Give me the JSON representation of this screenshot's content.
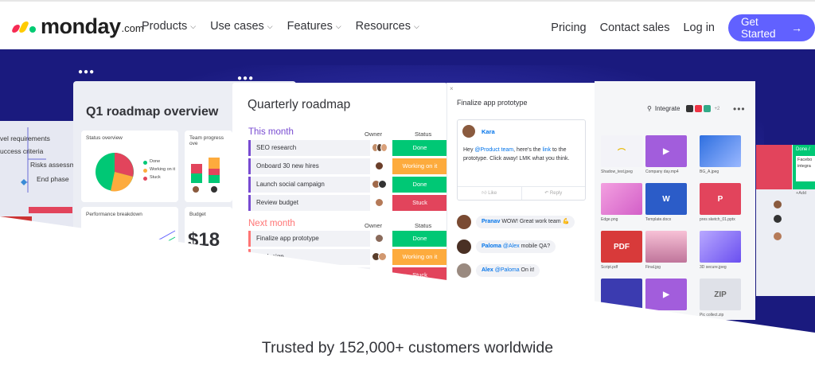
{
  "nav": {
    "logo_word": "monday",
    "logo_suffix": ".com",
    "menu": [
      {
        "label": "Products"
      },
      {
        "label": "Use cases"
      },
      {
        "label": "Features"
      },
      {
        "label": "Resources"
      }
    ],
    "pricing": "Pricing",
    "contact": "Contact sales",
    "login": "Log in",
    "cta": "Get Started",
    "cta_color": "#6161ff"
  },
  "hero": {
    "background_color": "#1a1a7e",
    "left_labels": [
      "vel requirements",
      "uccess criteria",
      "Risks assessm",
      "End phase"
    ],
    "overview": {
      "title": "Q1 roadmap overview",
      "status_overview": "Status overview",
      "legend": [
        "Done",
        "Working on it",
        "Stuck"
      ],
      "team_progress": "Team progress ove",
      "performance": "Performance breakdown",
      "budget": "Budget",
      "budget_value": "$18"
    },
    "roadmap": {
      "title": "Quarterly roadmap",
      "this_month": "This month",
      "next_month": "Next month",
      "owner_label": "Owner",
      "status_label": "Status",
      "rows_this": [
        {
          "name": "SEO research",
          "status": "Done",
          "color": "#00c875"
        },
        {
          "name": "Onboard 30 new hires",
          "status": "Working on it",
          "color": "#fdab3d"
        },
        {
          "name": "Launch social campaign",
          "status": "Done",
          "color": "#00c875"
        },
        {
          "name": "Review budget",
          "status": "Stuck",
          "color": "#e2445c"
        }
      ],
      "rows_next": [
        {
          "name": "Finalize app prototype",
          "status": "Done",
          "color": "#00c875"
        },
        {
          "name": "...edesign",
          "status": "Working on it",
          "color": "#fdab3d"
        },
        {
          "name": "",
          "status": "Stuck",
          "color": "#e2445c"
        }
      ]
    },
    "chat": {
      "close": "×",
      "title": "Finalize app prototype",
      "author": "Kara",
      "message_pre": "Hey ",
      "mention": "@Product team",
      "message_mid": ", here's the ",
      "link": "link",
      "message_post": " to the prototype. Click away! LMK what you think.",
      "like": "Like",
      "reply": "Reply",
      "replies": [
        {
          "name": "Pranav",
          "text": "WOW! Great work team 💪",
          "mention": ""
        },
        {
          "name": "Paloma",
          "mention": "@Alex",
          "text": "mobile QA?"
        },
        {
          "name": "Alex",
          "mention": "@Paloma",
          "text": "On it!"
        }
      ]
    },
    "files": {
      "integrate": "Integrate",
      "integrate_count": "+2",
      "tiles": [
        {
          "label": "",
          "caption": "Shadow_test.jpeg",
          "color": "#f3f3f8"
        },
        {
          "label": "▶",
          "caption": "Company day.mp4",
          "color": "#a25ddc"
        },
        {
          "label": "",
          "caption": "BG_A.jpeg",
          "color": "#4a78e0"
        },
        {
          "label": "",
          "caption": "Edge.png",
          "color": "#e87bd2"
        },
        {
          "label": "W",
          "caption": "Template.docx",
          "color": "#2b5cc8"
        },
        {
          "label": "P",
          "caption": "pres sketch_01.pptx",
          "color": "#e2445c"
        },
        {
          "label": "PDF",
          "caption": "Script.pdf",
          "color": "#d83a3a"
        },
        {
          "label": "",
          "caption": "Final.jpg",
          "color": "#e89ab8"
        },
        {
          "label": "",
          "caption": "3D secure.jpeg",
          "color": "#7b6cf0"
        },
        {
          "label": "",
          "caption": "",
          "color": "#3b3bb0"
        },
        {
          "label": "▶",
          "caption": "",
          "color": "#a25ddc"
        },
        {
          "label": "ZIP",
          "caption": "Pic collect.zip",
          "color": "#dfe1e8"
        }
      ]
    },
    "far_right": {
      "done": "Done /",
      "facebook": "Facebo",
      "integra": "integra",
      "add": "+Add"
    }
  },
  "trusted": "Trusted by 152,000+ customers worldwide"
}
